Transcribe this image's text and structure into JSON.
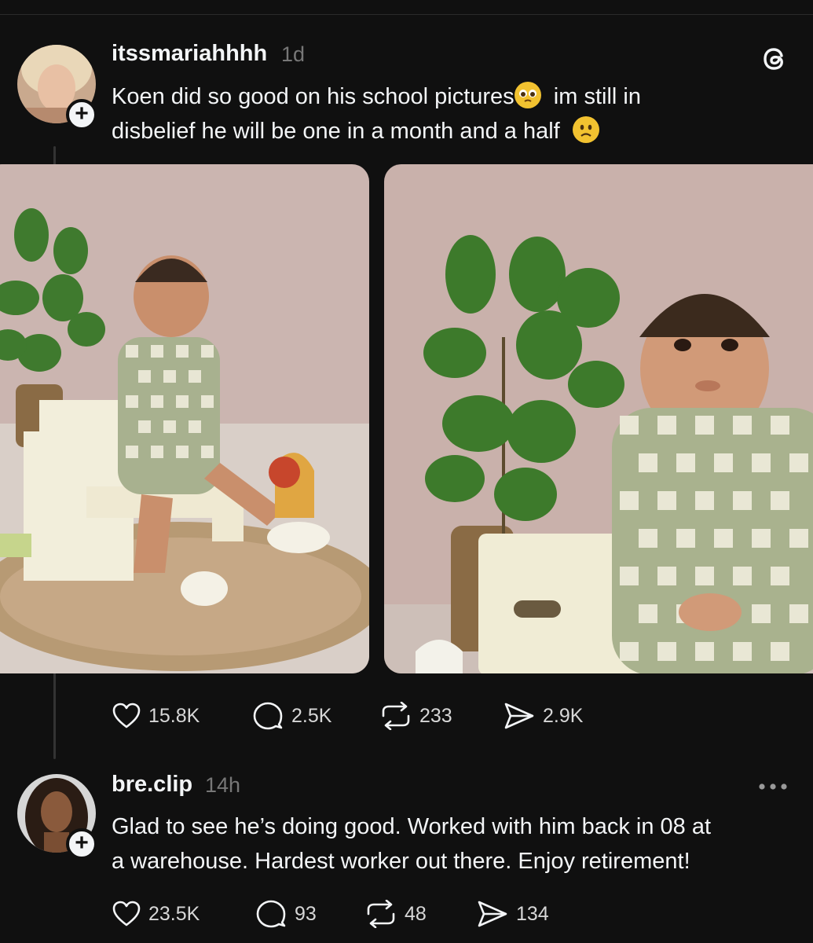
{
  "post1": {
    "username": "itssmariahhhh",
    "time": "1d",
    "text_line1": "Koen did so good on his school pictures",
    "text_line1b": "im still in",
    "text_line2": "disbelief he will be one in a month and a half",
    "emoji1": "pleading-face-emoji",
    "emoji2": "slightly-frowning-face-emoji",
    "stats": {
      "likes": "15.8K",
      "comments": "2.5K",
      "reposts": "233",
      "shares": "2.9K"
    }
  },
  "post2": {
    "username": "bre.clip",
    "time": "14h",
    "text_line1": "Glad to see he’s doing good. Worked with him back in 08 at",
    "text_line2": "a warehouse. Hardest worker out there. Enjoy retirement!",
    "stats": {
      "likes": "23.5K",
      "comments": "93",
      "reposts": "48",
      "shares": "134"
    }
  },
  "icons": {
    "threads": "threads-logo-icon",
    "like": "heart-icon",
    "comment": "comment-icon",
    "repost": "repost-icon",
    "share": "send-icon",
    "more": "more-dots-icon"
  },
  "colors": {
    "background": "#101010",
    "text": "#f3f5f7",
    "muted": "#777777"
  }
}
